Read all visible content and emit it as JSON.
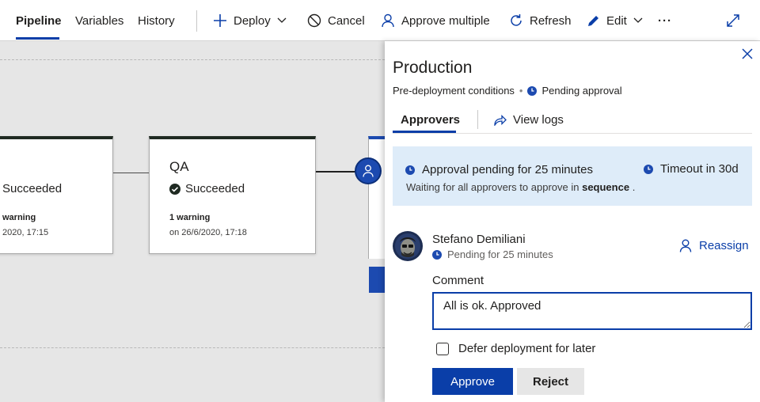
{
  "toolbar": {
    "tabs": [
      {
        "label": "Pipeline",
        "active": true
      },
      {
        "label": "Variables"
      },
      {
        "label": "History"
      }
    ],
    "actions": {
      "deploy": "Deploy",
      "cancel": "Cancel",
      "approve_multiple": "Approve multiple",
      "refresh": "Refresh",
      "edit": "Edit",
      "more": "···"
    },
    "icons": {
      "deploy": "plus-icon",
      "cancel": "cancel-circle-icon",
      "approve_multiple": "person-icon",
      "refresh": "refresh-icon",
      "edit": "pencil-icon",
      "expand": "expand-icon"
    }
  },
  "pipeline": {
    "stages": [
      {
        "name": "",
        "status": "Succeeded",
        "warnings": "warning",
        "date": "2020, 17:15"
      },
      {
        "name": "QA",
        "status": "Succeeded",
        "warnings": "1 warning",
        "date": "on 26/6/2020, 17:18"
      }
    ],
    "approval_icon": "person-icon",
    "colors": {
      "stage_top": "#1f2a22",
      "approval": "#1c4ab0"
    }
  },
  "panel": {
    "title": "Production",
    "subtitle": "Pre-deployment conditions",
    "subtitle_status": "Pending approval",
    "tabs": {
      "approvers": "Approvers",
      "view_logs": "View logs"
    },
    "banner": {
      "title": "Approval pending for 25 minutes",
      "timeout": "Timeout in 30d",
      "sub_prefix": "Waiting for all approvers to approve in",
      "sub_bold": "sequence",
      "sub_suffix": "."
    },
    "approver": {
      "name": "Stefano Demiliani",
      "status": "Pending for 25 minutes",
      "reassign": "Reassign"
    },
    "comment_label": "Comment",
    "comment_value": "All is ok. Approved",
    "defer_label": "Defer deployment for later",
    "defer_checked": false,
    "approve_label": "Approve",
    "reject_label": "Reject",
    "colors": {
      "accent": "#0a3ea8",
      "banner_bg": "#deecf9"
    }
  }
}
